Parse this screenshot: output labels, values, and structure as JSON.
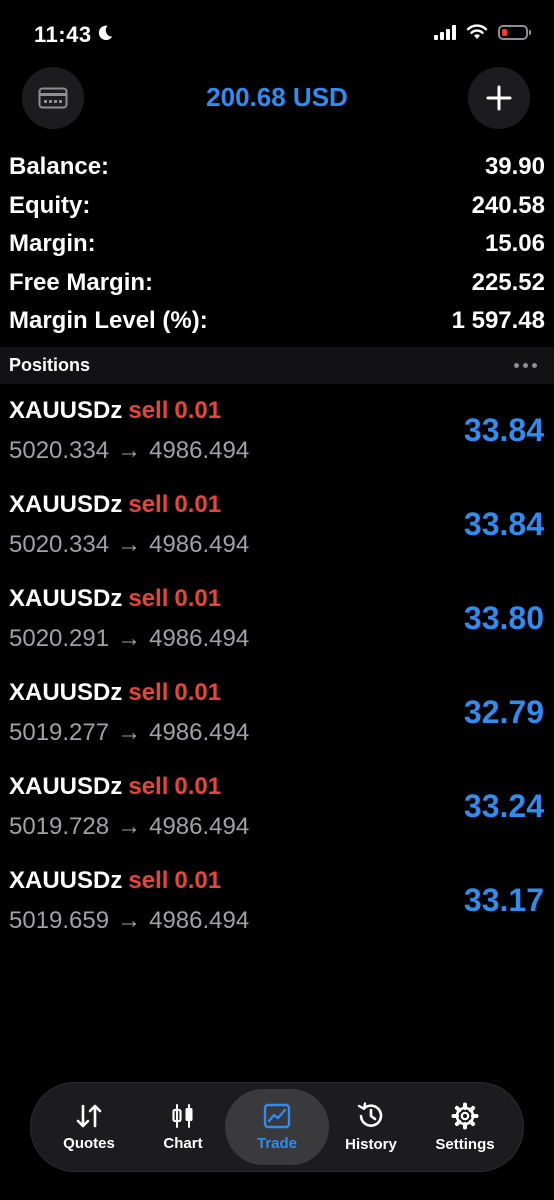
{
  "status_bar": {
    "time": "11:43"
  },
  "header": {
    "title": "200.68 USD"
  },
  "summary": [
    {
      "label": "Balance:",
      "value": "39.90"
    },
    {
      "label": "Equity:",
      "value": "240.58"
    },
    {
      "label": "Margin:",
      "value": "15.06"
    },
    {
      "label": "Free Margin:",
      "value": "225.52"
    },
    {
      "label": "Margin Level (%):",
      "value": "1 597.48"
    }
  ],
  "positions_title": "Positions",
  "positions": [
    {
      "symbol": "XAUUSDz",
      "side": "sell",
      "volume": "0.01",
      "open_price": "5020.334",
      "arrow": "→",
      "current_price": "4986.494",
      "profit": "33.84"
    },
    {
      "symbol": "XAUUSDz",
      "side": "sell",
      "volume": "0.01",
      "open_price": "5020.334",
      "arrow": "→",
      "current_price": "4986.494",
      "profit": "33.84"
    },
    {
      "symbol": "XAUUSDz",
      "side": "sell",
      "volume": "0.01",
      "open_price": "5020.291",
      "arrow": "→",
      "current_price": "4986.494",
      "profit": "33.80"
    },
    {
      "symbol": "XAUUSDz",
      "side": "sell",
      "volume": "0.01",
      "open_price": "5019.277",
      "arrow": "→",
      "current_price": "4986.494",
      "profit": "32.79"
    },
    {
      "symbol": "XAUUSDz",
      "side": "sell",
      "volume": "0.01",
      "open_price": "5019.728",
      "arrow": "→",
      "current_price": "4986.494",
      "profit": "33.24"
    },
    {
      "symbol": "XAUUSDz",
      "side": "sell",
      "volume": "0.01",
      "open_price": "5019.659",
      "arrow": "→",
      "current_price": "4986.494",
      "profit": "33.17"
    }
  ],
  "tabs": [
    {
      "label": "Quotes",
      "icon": "quotes-arrows-icon"
    },
    {
      "label": "Chart",
      "icon": "candlestick-icon"
    },
    {
      "label": "Trade",
      "icon": "trade-chart-icon",
      "active": true
    },
    {
      "label": "History",
      "icon": "history-clock-icon"
    },
    {
      "label": "Settings",
      "icon": "gear-icon"
    }
  ],
  "colors": {
    "accent": "#2f8cf0",
    "sell": "#e8443a",
    "muted": "#a1a1a6",
    "background": "#000000"
  }
}
